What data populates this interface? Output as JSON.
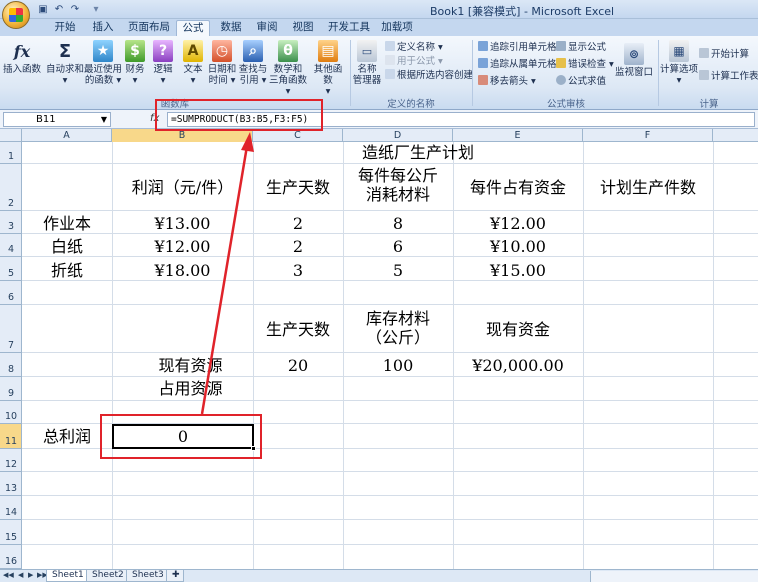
{
  "window": {
    "title": "Book1 [兼容模式] - Microsoft Excel"
  },
  "ribbon": {
    "tabs": [
      "开始",
      "插入",
      "页面布局",
      "公式",
      "数据",
      "审阅",
      "视图",
      "开发工具",
      "加载项"
    ],
    "active_tab": "公式",
    "function_library": {
      "label": "函数库",
      "insert_function": "插入函数",
      "autosum": [
        "自动求和",
        "▾"
      ],
      "recently_used": [
        "最近使用",
        "的函数 ▾"
      ],
      "financial": [
        "财务",
        "▾"
      ],
      "logical": [
        "逻辑",
        "▾"
      ],
      "text": [
        "文本",
        "▾"
      ],
      "datetime": [
        "日期和",
        "时间 ▾"
      ],
      "lookup": [
        "查找与",
        "引用 ▾"
      ],
      "math": [
        "数学和",
        "三角函数 ▾"
      ],
      "more": [
        "其他函数",
        "▾"
      ]
    },
    "defined_names": {
      "label": "定义的名称",
      "name_manager": [
        "名称",
        "管理器"
      ],
      "define_name": "定义名称 ▾",
      "use_in_formula": "用于公式 ▾",
      "create_from_selection": "根据所选内容创建"
    },
    "formula_auditing": {
      "label": "公式审核",
      "trace_precedents": "追踪引用单元格",
      "trace_dependents": "追踪从属单元格",
      "remove_arrows": "移去箭头 ▾",
      "show_formulas": "显示公式",
      "error_checking": "错误检查 ▾",
      "evaluate_formula": "公式求值",
      "watch_window": "监视窗口"
    },
    "calculation": {
      "label": "计算",
      "calc_options": [
        "计算选项",
        "▾"
      ],
      "calc_now": "开始计算",
      "calc_sheet": "计算工作表"
    }
  },
  "formula_bar": {
    "name_box": "B11",
    "fx": "fx",
    "formula": "=SUMPRODUCT(B3:B5,F3:F5)"
  },
  "columns": [
    "A",
    "B",
    "C",
    "D",
    "E",
    "F"
  ],
  "rows": [
    "1",
    "2",
    "3",
    "4",
    "5",
    "6",
    "7",
    "8",
    "9",
    "10",
    "11",
    "12",
    "13",
    "14",
    "15",
    "16"
  ],
  "cells": {
    "title": "造纸厂生产计划",
    "h_profit": "利润（元/件）",
    "h_days": "生产天数",
    "h_material": [
      "每件每公斤",
      "消耗材料"
    ],
    "h_capital": "每件占有资金",
    "h_plan": "计划生产件数",
    "r3": {
      "a": "作业本",
      "b": "¥13.00",
      "c": "2",
      "d": "8",
      "e": "¥12.00"
    },
    "r4": {
      "a": "白纸",
      "b": "¥12.00",
      "c": "2",
      "d": "6",
      "e": "¥10.00"
    },
    "r5": {
      "a": "折纸",
      "b": "¥18.00",
      "c": "3",
      "d": "5",
      "e": "¥15.00"
    },
    "h7_days": "生产天数",
    "h7_stock": [
      "库存材料",
      "（公斤）"
    ],
    "h7_capital": "现有资金",
    "r8": {
      "label": "现有资源",
      "c": "20",
      "d": "100",
      "e": "¥20,000.00"
    },
    "r9_label": "占用资源",
    "r11": {
      "label": "总利润",
      "value": "0"
    }
  },
  "sheets": [
    "Sheet1",
    "Sheet2",
    "Sheet3"
  ],
  "colors": {
    "annotation": "#e0232a",
    "selected_header": "#f8d88a"
  }
}
